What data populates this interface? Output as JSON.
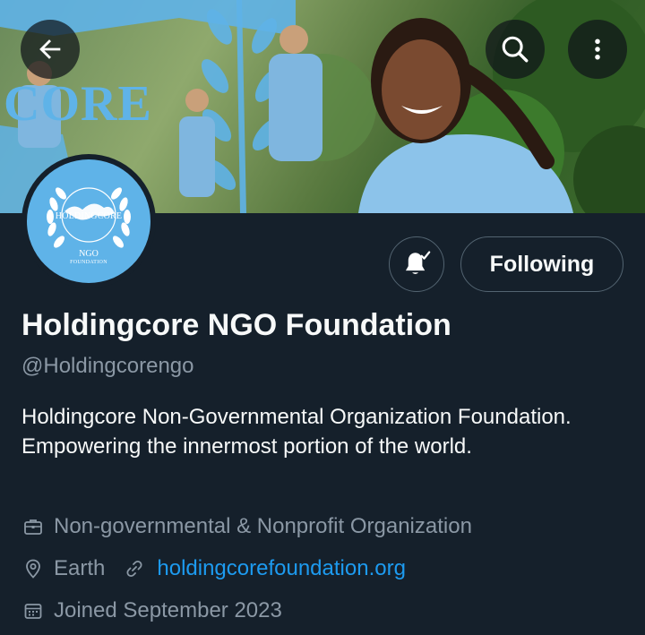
{
  "banner": {
    "overlay_text": "CORE"
  },
  "nav": {
    "back_icon": "arrow-left-icon",
    "search_icon": "search-icon",
    "more_icon": "more-vertical-icon"
  },
  "avatar": {
    "title": "HOLDINGCORE",
    "ngo": "NGO",
    "sub": "FOUNDATION"
  },
  "actions": {
    "notify_icon": "bell-check-icon",
    "following_label": "Following"
  },
  "profile": {
    "name": "Holdingcore NGO Foundation",
    "handle": "@Holdingcorengo",
    "bio": "Holdingcore Non-Governmental Organization Foundation. Empowering the innermost portion of the world.",
    "category": "Non-governmental & Nonprofit Organization",
    "location": "Earth",
    "website": "holdingcorefoundation.org",
    "joined": "Joined September 2023"
  },
  "colors": {
    "background": "#15202b",
    "text_primary": "#f7f9f9",
    "text_secondary": "#8b98a5",
    "link": "#1d9bf0",
    "brand_blue": "#5fb3e8"
  }
}
